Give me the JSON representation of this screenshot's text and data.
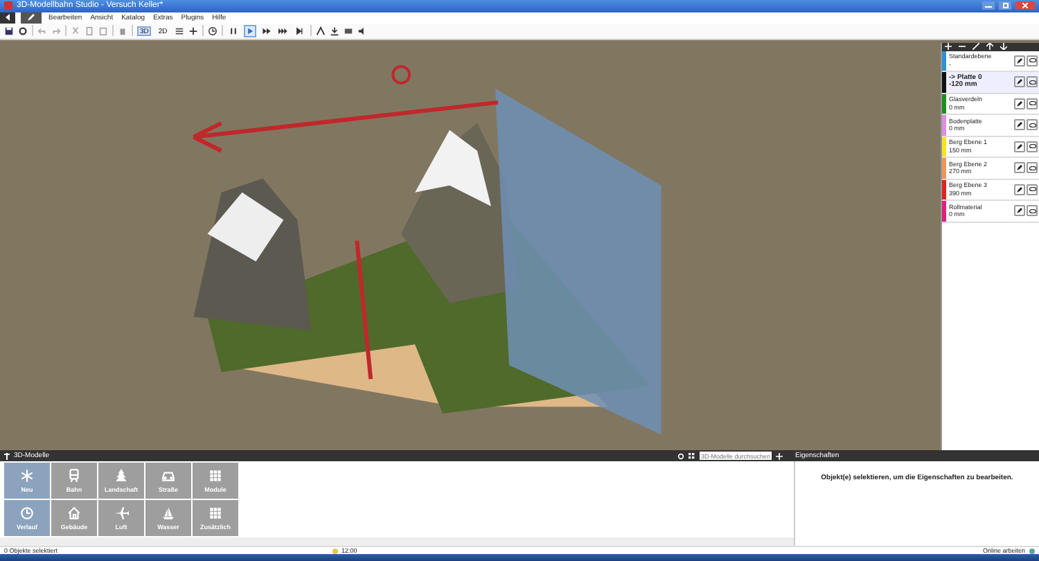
{
  "window": {
    "title": "3D-Modellbahn Studio - Versuch Keller*"
  },
  "menu": [
    "Bearbeiten",
    "Ansicht",
    "Katalog",
    "Extras",
    "Plugins",
    "Hilfe"
  ],
  "toolbar": {
    "view_modes": [
      {
        "label": "3D",
        "selected": true
      },
      {
        "label": "2D",
        "selected": false
      }
    ],
    "playback": [
      {
        "kind": "pause",
        "selected": false
      },
      {
        "kind": "play",
        "selected": true
      },
      {
        "kind": "fast",
        "selected": false
      },
      {
        "kind": "faster",
        "selected": false
      },
      {
        "kind": "step",
        "selected": false
      }
    ]
  },
  "layers": [
    {
      "name": "Standardebene",
      "detail": "-",
      "color": "#2e8fd8",
      "selected": false
    },
    {
      "name": "-> Platte 0",
      "detail": "-120 mm",
      "color": "#111111",
      "selected": true
    },
    {
      "name": "Glasverdeln",
      "detail": "0 mm",
      "color": "#1f8f1f",
      "selected": false
    },
    {
      "name": "Bodenplatte",
      "detail": "0 mm",
      "color": "#e08ce0",
      "selected": false
    },
    {
      "name": "Berg Ebene 1",
      "detail": "150 mm",
      "color": "#f5e51b",
      "selected": false
    },
    {
      "name": "Berg Ebene 2",
      "detail": "270 mm",
      "color": "#f0945a",
      "selected": false
    },
    {
      "name": "Berg Ebene 3",
      "detail": "390 mm",
      "color": "#e0231e",
      "selected": false
    },
    {
      "name": "Rollmaterial",
      "detail": "0 mm",
      "color": "#e0207a",
      "selected": false
    }
  ],
  "models_panel": {
    "title": "3D-Modelle",
    "search": {
      "placeholder": "3D-Modelle durchsuchen"
    },
    "categories": [
      {
        "label": "Neu",
        "kind": "asterisk",
        "selected": true
      },
      {
        "label": "Bahn",
        "kind": "train",
        "selected": false
      },
      {
        "label": "Landschaft",
        "kind": "tree",
        "selected": false
      },
      {
        "label": "Straße",
        "kind": "car",
        "selected": false
      },
      {
        "label": "Module",
        "kind": "grid",
        "selected": false
      },
      {
        "label": "Verlauf",
        "kind": "clock",
        "selected": true
      },
      {
        "label": "Gebäude",
        "kind": "house",
        "selected": false
      },
      {
        "label": "Luft",
        "kind": "plane",
        "selected": false
      },
      {
        "label": "Wasser",
        "kind": "boat",
        "selected": false
      },
      {
        "label": "Zusätzlich",
        "kind": "grid",
        "selected": false
      }
    ]
  },
  "properties_panel": {
    "title": "Eigenschaften",
    "message": "Objekt(e) selektieren, um die Eigenschaften zu bearbeiten."
  },
  "status_bar": {
    "selection": "0 Objekte selektiert",
    "time": "12:00",
    "mode": "Online arbeiten"
  }
}
